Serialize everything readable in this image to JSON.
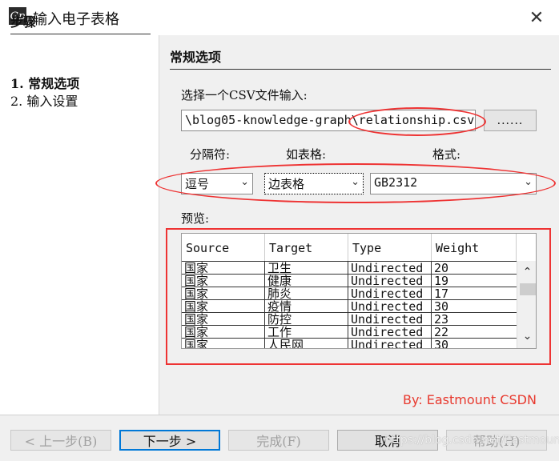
{
  "window": {
    "title": "输入电子表格",
    "app_icon_text": "Gp"
  },
  "sidebar": {
    "heading": "步骤",
    "steps": [
      {
        "label": "1. 常规选项",
        "active": true
      },
      {
        "label": "2. 输入设置",
        "active": false
      }
    ]
  },
  "main": {
    "heading": "常规选项",
    "file_prompt": "选择一个CSV文件输入:",
    "file_path": "\\blog05-knowledge-graph\\relationship.csv",
    "browse_label": "......",
    "separator_label": "分隔符:",
    "as_table_label": "如表格:",
    "format_label": "格式:",
    "separator_value": "逗号",
    "as_table_value": "边表格",
    "format_value": "GB2312",
    "preview_label": "预览:"
  },
  "preview": {
    "columns": [
      "Source",
      "Target",
      "Type",
      "Weight"
    ],
    "rows": [
      [
        "国家",
        "卫生",
        "Undirected",
        "20"
      ],
      [
        "国家",
        "健康",
        "Undirected",
        "19"
      ],
      [
        "国家",
        "肺炎",
        "Undirected",
        "17"
      ],
      [
        "国家",
        "疫情",
        "Undirected",
        "30"
      ],
      [
        "国家",
        "防控",
        "Undirected",
        "23"
      ],
      [
        "国家",
        "工作",
        "Undirected",
        "22"
      ],
      [
        "国家",
        "人民网",
        "Undirected",
        "30"
      ]
    ]
  },
  "annotation": "By:  Eastmount CSDN",
  "buttons": {
    "back": "< 上一步(B)",
    "next": "下一步 >",
    "finish": "完成(F)",
    "cancel": "取消",
    "help": "帮助(H)"
  },
  "watermark": "https://blog.csdn.net/Eastmount",
  "colors": {
    "annotation_red": "#e33333",
    "default_button_border": "#0078d7"
  }
}
